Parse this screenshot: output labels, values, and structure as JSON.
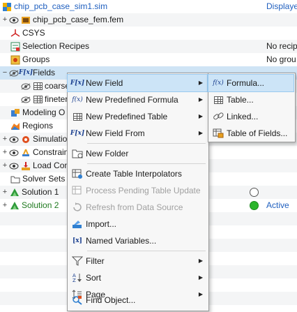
{
  "tree": {
    "rows": [
      {
        "label": "chip_pcb_case_sim1.sim",
        "status": "Displaye"
      },
      {
        "label": "chip_pcb_case_fem.fem",
        "status": ""
      },
      {
        "label": "CSYS",
        "status": ""
      },
      {
        "label": "Selection Recipes",
        "status": "No recip"
      },
      {
        "label": "Groups",
        "status": "No grou"
      },
      {
        "label": "Fields",
        "status": ""
      },
      {
        "label": "coarse",
        "status": "r"
      },
      {
        "label": "fineter",
        "status": "r"
      },
      {
        "label": "Modeling O",
        "status": ""
      },
      {
        "label": "Regions",
        "status": ""
      },
      {
        "label": "Simulatio",
        "status": ""
      },
      {
        "label": "Constrain",
        "status": ""
      },
      {
        "label": "Load Con",
        "status": ""
      },
      {
        "label": "Solver Sets",
        "status": ""
      },
      {
        "label": "Solution 1",
        "status": ""
      },
      {
        "label": "Solution 2",
        "status": "Active"
      }
    ]
  },
  "context_menu": {
    "items": [
      {
        "label": "New Field",
        "icon": "fx-icon"
      },
      {
        "label": "New Predefined Formula",
        "icon": "fx-italic-icon"
      },
      {
        "label": "New Predefined Table",
        "icon": "table-icon"
      },
      {
        "label": "New Field From",
        "icon": "fx-icon"
      },
      {
        "label": "New Folder",
        "icon": "folder-icon"
      },
      {
        "label": "Create Table Interpolators",
        "icon": "table-interpolator-icon"
      },
      {
        "label": "Process Pending Table Update",
        "icon": "table-update-icon"
      },
      {
        "label": "Refresh from Data Source",
        "icon": "refresh-icon"
      },
      {
        "label": "Import...",
        "icon": "import-icon"
      },
      {
        "label": "Named Variables...",
        "icon": "named-variables-icon"
      },
      {
        "label": "Filter",
        "icon": "filter-icon"
      },
      {
        "label": "Sort",
        "icon": "sort-icon"
      },
      {
        "label": "Page",
        "icon": "page-icon"
      },
      {
        "label": "Find Object...",
        "icon": "find-object-icon"
      }
    ]
  },
  "submenu": {
    "items": [
      {
        "label": "Formula...",
        "icon": "fx-italic-icon"
      },
      {
        "label": "Table...",
        "icon": "table-icon"
      },
      {
        "label": "Linked...",
        "icon": "link-icon"
      },
      {
        "label": "Table of Fields...",
        "icon": "table-of-fields-icon"
      }
    ]
  },
  "colors": {
    "highlight": "#cce4f7",
    "active_green": "#2bb52b",
    "link_blue": "#1f5fbf"
  }
}
